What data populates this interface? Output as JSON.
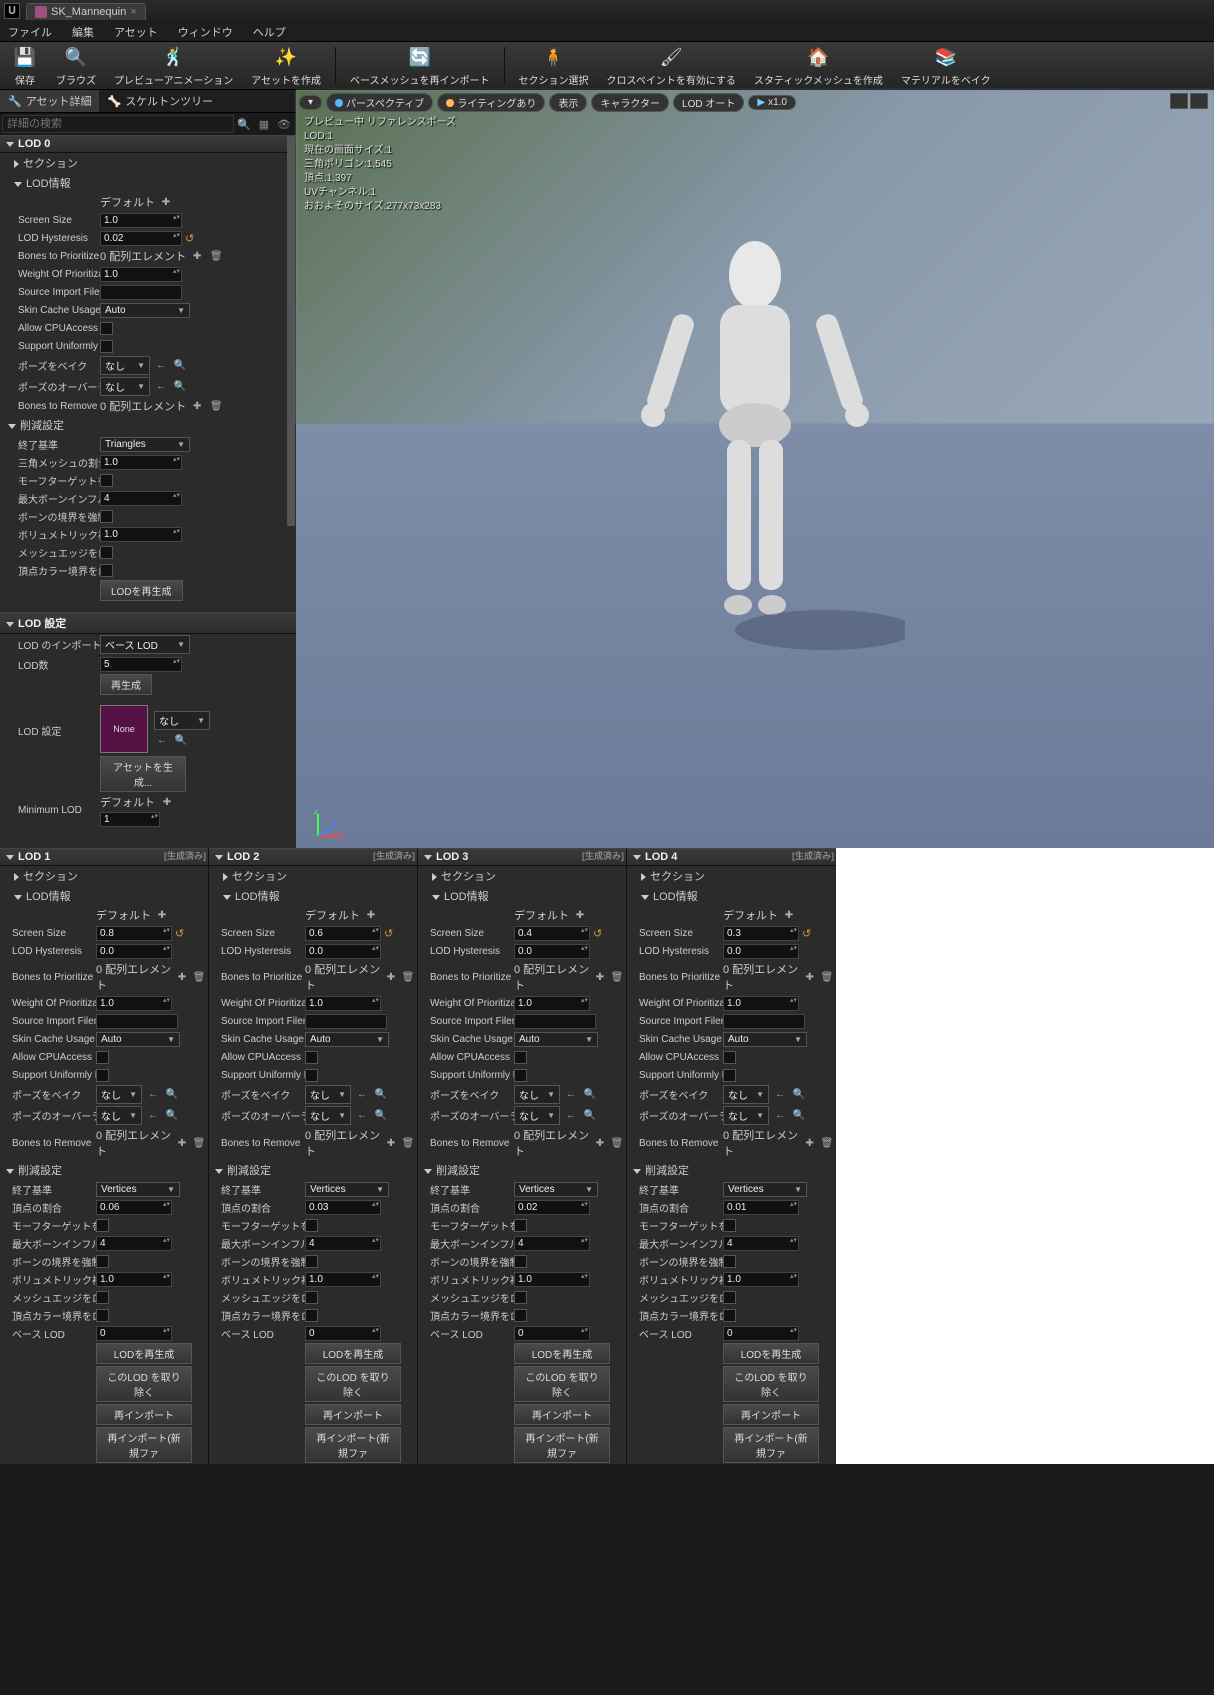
{
  "title_tab": "SK_Mannequin",
  "menubar": [
    "ファイル",
    "編集",
    "アセット",
    "ウィンドウ",
    "ヘルプ"
  ],
  "toolbar": [
    {
      "icon": "💾",
      "label": "保存"
    },
    {
      "icon": "🔍",
      "label": "ブラウズ"
    },
    {
      "icon": "🕺",
      "label": "プレビューアニメーション"
    },
    {
      "icon": "✨",
      "label": "アセットを作成"
    },
    {
      "icon": "🔄",
      "label": "ベースメッシュを再インポート"
    },
    {
      "icon": "🧍",
      "label": "セクション選択"
    },
    {
      "icon": "🖌",
      "label": "クロスペイントを有効にする"
    },
    {
      "icon": "🏠",
      "label": "スタティックメッシュを作成"
    },
    {
      "icon": "📚",
      "label": "マテリアルをベイク"
    }
  ],
  "left_tabs": {
    "asset_detail": "アセット詳細",
    "skeleton_tree": "スケルトンツリー"
  },
  "search_placeholder": "詳細の検索",
  "lod0": {
    "header": "LOD 0",
    "section": "セクション",
    "lod_info": "LOD情報",
    "default_label": "デフォルト",
    "screen_size": {
      "lbl": "Screen Size",
      "val": "1.0"
    },
    "lod_hyst": {
      "lbl": "LOD Hysteresis",
      "val": "0.02"
    },
    "bones_prio": {
      "lbl": "Bones to Prioritize",
      "val": "0 配列エレメント"
    },
    "weight_prio": {
      "lbl": "Weight Of Prioritiza",
      "val": "1.0"
    },
    "src_import": {
      "lbl": "Source Import Filen"
    },
    "skin_cache": {
      "lbl": "Skin Cache Usage",
      "val": "Auto"
    },
    "allow_cpu": {
      "lbl": "Allow CPUAccess"
    },
    "support_uni": {
      "lbl": "Support Uniformly D"
    },
    "pose_bake": {
      "lbl": "ポーズをベイク",
      "val": "なし"
    },
    "pose_overlap": {
      "lbl": "ポーズのオーバーラ",
      "val": "なし"
    },
    "bones_remove": {
      "lbl": "Bones to Remove",
      "val": "0 配列エレメント"
    },
    "reduction_hdr": "削減設定",
    "end_crit": {
      "lbl": "終了基準",
      "val": "Triangles"
    },
    "tri_ratio": {
      "lbl": "三角メッシュの割合",
      "val": "1.0"
    },
    "morph_tgt": {
      "lbl": "モーフターゲットを削"
    },
    "max_bone_infl": {
      "lbl": "最大ボーンインフル",
      "val": "4"
    },
    "bone_bound": {
      "lbl": "ボーンの境界を強制"
    },
    "volum_corr": {
      "lbl": "ボリュメトリック補正",
      "val": "1.0"
    },
    "mesh_edge": {
      "lbl": "メッシュエッジをロッ"
    },
    "vert_color": {
      "lbl": "頂点カラー境界をロ"
    },
    "regen_lod_btn": "LODを再生成",
    "lod_settings_hdr": "LOD 設定",
    "lod_import": {
      "lbl": "LOD のインポート",
      "val": "ベース LOD"
    },
    "lod_count": {
      "lbl": "LOD数",
      "val": "5"
    },
    "regen_btn": "再生成",
    "lod_setting_row": "LOD 設定",
    "none": "None",
    "none_dd": "なし",
    "gen_asset_btn": "アセットを生成...",
    "min_lod": {
      "lbl": "Minimum LOD",
      "default": "デフォルト",
      "val": "1"
    }
  },
  "viewport": {
    "pills": [
      "パースペクティブ",
      "ライティングあり",
      "表示",
      "キャラクター",
      "LOD オート",
      "x1.0"
    ],
    "stats": [
      "プレビュー中 リファレンスポーズ",
      "LOD:1",
      "現在の画面サイズ:1",
      "三角ポリゴン:1,545",
      "頂点:1,397",
      "UVチャンネル:1",
      "おおよそのサイズ:277x73x283"
    ]
  },
  "lod_cols": [
    {
      "hdr": "LOD 1",
      "gen": "[生成済み]",
      "ss": "0.8",
      "hyst": "0.0",
      "end": "Vertices",
      "vratio_lbl": "頂点の割合",
      "vratio": "0.06",
      "baselod": "0"
    },
    {
      "hdr": "LOD 2",
      "gen": "[生成済み]",
      "ss": "0.6",
      "hyst": "0.0",
      "end": "Vertices",
      "vratio_lbl": "頂点の割合",
      "vratio": "0.03",
      "baselod": "0"
    },
    {
      "hdr": "LOD 3",
      "gen": "[生成済み]",
      "ss": "0.4",
      "hyst": "0.0",
      "end": "Vertices",
      "vratio_lbl": "頂点の割合",
      "vratio": "0.02",
      "baselod": "0"
    },
    {
      "hdr": "LOD 4",
      "gen": "[生成済み]",
      "ss": "0.3",
      "hyst": "0.0",
      "end": "Vertices",
      "vratio_lbl": "頂点の割合",
      "vratio": "0.01",
      "baselod": "0"
    }
  ],
  "shared": {
    "section": "セクション",
    "lod_info": "LOD情報",
    "default": "デフォルト",
    "screen_size": "Screen Size",
    "lod_hyst": "LOD Hysteresis",
    "bones_prio": "Bones to Prioritize",
    "bones_prio_val": "0 配列エレメント",
    "weight_prio": "Weight Of Prioritiza",
    "weight_val": "1.0",
    "src_import": "Source Import Filen",
    "skin_cache": "Skin Cache Usage",
    "auto": "Auto",
    "allow_cpu": "Allow CPUAccess",
    "support_uni": "Support Uniformly D",
    "pose_bake": "ポーズをベイク",
    "pose_overlap": "ポーズのオーバーラ",
    "none": "なし",
    "bones_remove": "Bones to Remove",
    "reduction": "削減設定",
    "end_crit": "終了基準",
    "morph_tgt": "モーフターゲットを削",
    "max_bone": "最大ボーンインフル",
    "max_bone_val": "4",
    "bone_bound": "ボーンの境界を強制",
    "volum": "ボリュメトリック補正",
    "volum_val": "1.0",
    "mesh_edge": "メッシュエッジをロッ",
    "vert_color": "頂点カラー境界をロ",
    "base_lod": "ベース LOD",
    "regen_lod": "LODを再生成",
    "remove_lod": "このLOD を取り除く",
    "reimport": "再インポート",
    "reimport_new": "再インポート(新規ファ"
  }
}
